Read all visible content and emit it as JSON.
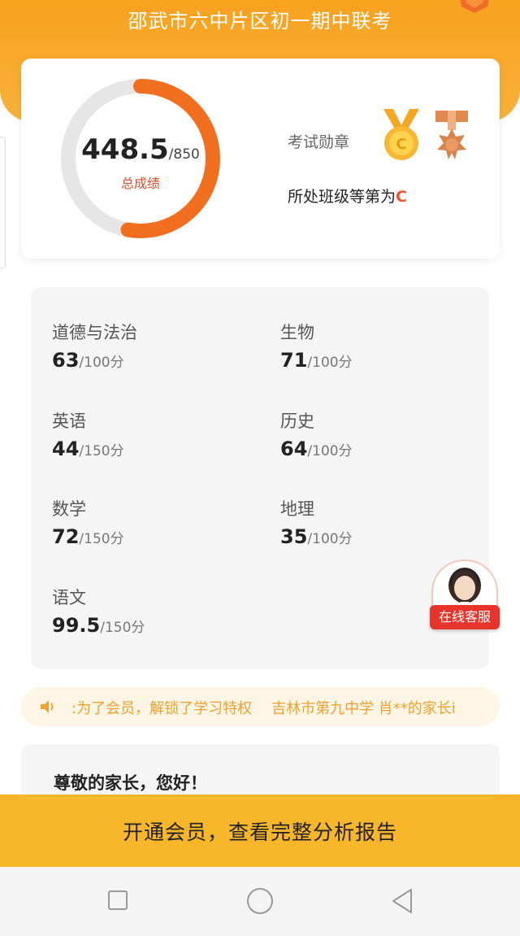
{
  "header": {
    "title": "邵武市六中片区初一期中联考"
  },
  "score": {
    "total": "448.5",
    "max": "/850",
    "label": "总成绩",
    "fraction": 0.5276
  },
  "medals": {
    "label": "考试勋章",
    "rank_prefix": "所处班级等第为",
    "rank_grade": "C",
    "gold_letter": "C"
  },
  "subjects": [
    {
      "name": "道德与法治",
      "score": "63",
      "max": "/100分"
    },
    {
      "name": "生物",
      "score": "71",
      "max": "/100分"
    },
    {
      "name": "英语",
      "score": "44",
      "max": "/150分"
    },
    {
      "name": "历史",
      "score": "64",
      "max": "/100分"
    },
    {
      "name": "数学",
      "score": "72",
      "max": "/150分"
    },
    {
      "name": "地理",
      "score": "35",
      "max": "/100分"
    },
    {
      "name": "语文",
      "score": "99.5",
      "max": "/150分"
    }
  ],
  "service": {
    "label": "在线客服"
  },
  "ticker": {
    "messages": [
      ":为了会员，解锁了学习特权",
      "吉林市第九中学 肖**的家长i"
    ]
  },
  "greeting": "尊敬的家长，您好！",
  "cta": {
    "label": "开通会员，查看完整分析报告"
  },
  "colors": {
    "accent": "#f8b62a",
    "ring": "#f26f1f",
    "ring_track": "#e6e6e6",
    "rank": "#e8552f"
  }
}
